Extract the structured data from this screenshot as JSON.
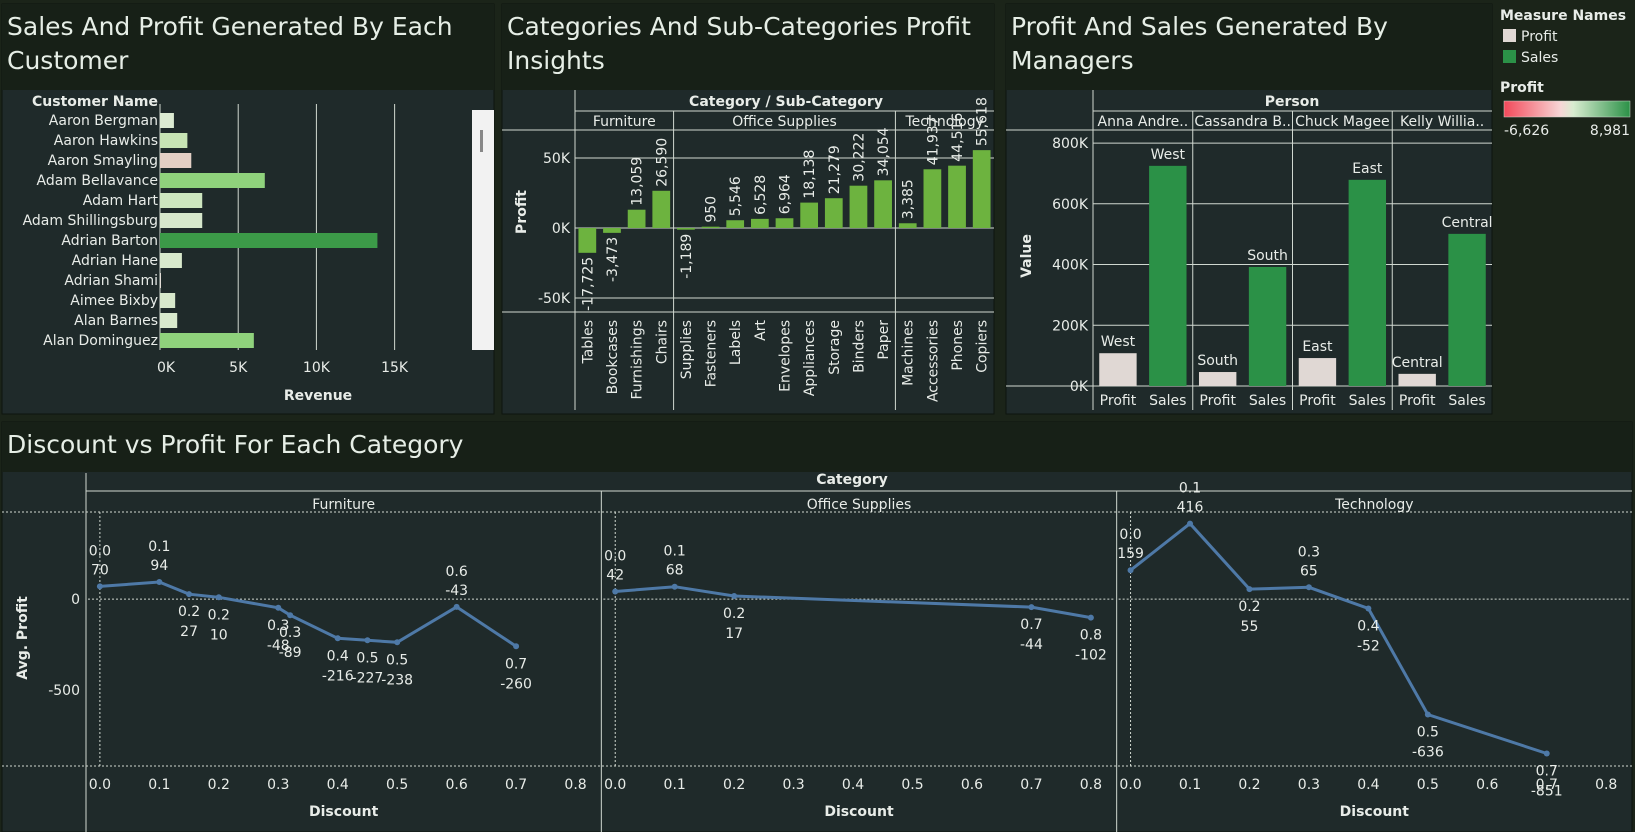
{
  "colors": {
    "page_bg": "#1b2419",
    "panel_bg": "#1f2a2a",
    "title_bg": "#172017",
    "title_text": "#e6eee6",
    "text": "#e8ece8",
    "grid": "#e8ece8",
    "dot": "#cfd8cf",
    "profit_bar": "#e0d8d4",
    "sales_bar": "#2b9147",
    "line": "#4e79a7",
    "bar_green": "#6db33f",
    "scroll_track": "#f2f2f2",
    "scroll_thumb": "#888888",
    "neg": "#e15759",
    "pos": "#2b9147"
  },
  "legend": {
    "measure_title": "Measure Names",
    "items": [
      {
        "label": "Profit",
        "color": "#e0d8d4"
      },
      {
        "label": "Sales",
        "color": "#2b9147"
      }
    ],
    "profit_title": "Profit",
    "profit_min": "-6,626",
    "profit_max": "8,981"
  },
  "chart_data": [
    {
      "type": "bar",
      "orientation": "horizontal",
      "title": "Sales And Profit Generated By Each Customer",
      "row_header": "Customer Name",
      "xlabel": "Revenue",
      "xticks": [
        "0K",
        "5K",
        "10K",
        "15K"
      ],
      "xtick_values": [
        0,
        5000,
        10000,
        15000
      ],
      "xlim": [
        0,
        19500
      ],
      "categories": [
        "Aaron Bergman",
        "Aaron Hawkins",
        "Aaron Smayling",
        "Adam Bellavance",
        "Adam Hart",
        "Adam Shillingsburg",
        "Adrian Barton",
        "Adrian Hane",
        "Adrian Shami",
        "Aimee Bixby",
        "Alan Barnes",
        "Alan Dominguez"
      ],
      "values": [
        890,
        1750,
        2000,
        6700,
        2700,
        2700,
        13900,
        1400,
        60,
        970,
        1100,
        6000
      ],
      "colors": [
        "#dcebd2",
        "#c7e4b4",
        "#e3cfc4",
        "#8fd27c",
        "#cde6bf",
        "#d6e7cb",
        "#3c9a48",
        "#d8e9cc",
        "#f0e8e2",
        "#d7e8cb",
        "#d8e9cc",
        "#8fd27c"
      ]
    },
    {
      "type": "bar",
      "title": "Categories And Sub-Categories Profit Insights",
      "header": "Category / Sub-Category",
      "ylabel": "Profit",
      "yticks": [
        "50K",
        "0K",
        "-50K"
      ],
      "ytick_values": [
        50000,
        0,
        -50000
      ],
      "ylim": [
        -60000,
        70000
      ],
      "groups": [
        {
          "name": "Furniture",
          "categories": [
            "Tables",
            "Bookcases",
            "Furnishings",
            "Chairs"
          ],
          "values": [
            -17725,
            -3473,
            13059,
            26590
          ],
          "labels": [
            "-17,725",
            "-3,473",
            "13,059",
            "26,590"
          ]
        },
        {
          "name": "Office Supplies",
          "categories": [
            "Supplies",
            "Fasteners",
            "Labels",
            "Art",
            "Envelopes",
            "Appliances",
            "Storage",
            "Binders",
            "Paper"
          ],
          "values": [
            -1189,
            950,
            5546,
            6528,
            6964,
            18138,
            21279,
            30222,
            34054
          ],
          "labels": [
            "-1,189",
            "950",
            "5,546",
            "6,528",
            "6,964",
            "18,138",
            "21,279",
            "30,222",
            "34,054"
          ]
        },
        {
          "name": "Technology",
          "categories": [
            "Machines",
            "Accessories",
            "Phones",
            "Copiers"
          ],
          "values": [
            3385,
            41937,
            44516,
            55618
          ],
          "labels": [
            "3,385",
            "41,937",
            "44,516",
            "55,618"
          ]
        }
      ]
    },
    {
      "type": "bar",
      "title": "Profit And Sales Generated By Managers",
      "header": "Person",
      "ylabel": "Value",
      "yticks": [
        "800K",
        "600K",
        "400K",
        "200K",
        "0K"
      ],
      "ytick_values": [
        800000,
        600000,
        400000,
        200000,
        0
      ],
      "ylim": [
        0,
        820000
      ],
      "persons": [
        {
          "name": "Anna Andre..",
          "region": "West",
          "profit": 108000,
          "sales": 725000
        },
        {
          "name": "Cassandra B..",
          "region": "South",
          "profit": 46000,
          "sales": 392000
        },
        {
          "name": "Chuck Magee",
          "region": "East",
          "profit": 92000,
          "sales": 679000
        },
        {
          "name": "Kelly Willia..",
          "region": "Central",
          "profit": 40000,
          "sales": 501000
        }
      ],
      "measures": [
        "Profit",
        "Sales"
      ]
    },
    {
      "type": "line",
      "title": "Discount vs Profit For Each Category",
      "header": "Category",
      "xlabel": "Discount",
      "ylabel": "Avg. Profit",
      "yticks": [
        "0",
        "-500"
      ],
      "ytick_values": [
        0,
        -500
      ],
      "ylim": [
        -920,
        480
      ],
      "xticks": [
        "0.0",
        "0.1",
        "0.2",
        "0.3",
        "0.4",
        "0.5",
        "0.6",
        "0.7",
        "0.8"
      ],
      "xlim": [
        -0.02,
        0.84
      ],
      "series": [
        {
          "category": "Furniture",
          "points": [
            {
              "x": 0.0,
              "y": 70,
              "xl": "0.0",
              "yl": "70"
            },
            {
              "x": 0.1,
              "y": 94,
              "xl": "0.1",
              "yl": "94"
            },
            {
              "x": 0.15,
              "y": 27,
              "xl": "0.2",
              "yl": "27"
            },
            {
              "x": 0.2,
              "y": 10,
              "xl": "0.2",
              "yl": "10"
            },
            {
              "x": 0.3,
              "y": -48,
              "xl": "0.3",
              "yl": "-48"
            },
            {
              "x": 0.32,
              "y": -89,
              "xl": "0.3",
              "yl": "-89"
            },
            {
              "x": 0.4,
              "y": -216,
              "xl": "0.4",
              "yl": "-216"
            },
            {
              "x": 0.45,
              "y": -227,
              "xl": "0.5",
              "yl": "-227"
            },
            {
              "x": 0.5,
              "y": -238,
              "xl": "0.5",
              "yl": "-238"
            },
            {
              "x": 0.6,
              "y": -43,
              "xl": "0.6",
              "yl": "-43"
            },
            {
              "x": 0.7,
              "y": -260,
              "xl": "0.7",
              "yl": "-260"
            }
          ]
        },
        {
          "category": "Office Supplies",
          "points": [
            {
              "x": 0.0,
              "y": 42,
              "xl": "0.0",
              "yl": "42"
            },
            {
              "x": 0.1,
              "y": 68,
              "xl": "0.1",
              "yl": "68"
            },
            {
              "x": 0.2,
              "y": 17,
              "xl": "0.2",
              "yl": "17"
            },
            {
              "x": 0.7,
              "y": -44,
              "xl": "0.7",
              "yl": "-44"
            },
            {
              "x": 0.8,
              "y": -102,
              "xl": "0.8",
              "yl": "-102"
            }
          ]
        },
        {
          "category": "Technology",
          "points": [
            {
              "x": 0.0,
              "y": 159,
              "xl": "0.0",
              "yl": "159"
            },
            {
              "x": 0.1,
              "y": 416,
              "xl": "0.1",
              "yl": "416"
            },
            {
              "x": 0.2,
              "y": 55,
              "xl": "0.2",
              "yl": "55"
            },
            {
              "x": 0.3,
              "y": 65,
              "xl": "0.3",
              "yl": "65"
            },
            {
              "x": 0.4,
              "y": -52,
              "xl": "0.4",
              "yl": "-52"
            },
            {
              "x": 0.5,
              "y": -636,
              "xl": "0.5",
              "yl": "-636"
            },
            {
              "x": 0.7,
              "y": -851,
              "xl": "0.7",
              "yl": "-851"
            }
          ]
        }
      ]
    }
  ]
}
